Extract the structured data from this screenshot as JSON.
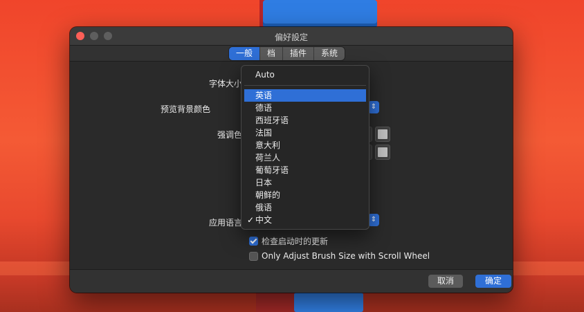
{
  "window": {
    "title": "偏好設定"
  },
  "tabs": [
    {
      "label": "一般",
      "active": true
    },
    {
      "label": "档",
      "active": false
    },
    {
      "label": "插件",
      "active": false
    },
    {
      "label": "系统",
      "active": false
    }
  ],
  "settings": {
    "font_size_label": "字体大小",
    "preview_bg_label": "预览背景颜色",
    "accent_label": "强调色",
    "app_language_label": "应用语言",
    "check_updates_label": "检查启动时的更新",
    "check_updates_checked": true,
    "brush_scroll_label": "Only Adjust Brush Size with Scroll Wheel",
    "brush_scroll_checked": false
  },
  "language_menu": {
    "auto_label": "Auto",
    "items": [
      "英语",
      "德语",
      "西班牙语",
      "法国",
      "意大利",
      "荷兰人",
      "葡萄牙语",
      "日本",
      "朝鲜的",
      "俄语",
      "中文"
    ],
    "highlighted": "英语",
    "selected": "中文",
    "check_glyph": "✓"
  },
  "footer": {
    "cancel_label": "取消",
    "ok_label": "确定"
  },
  "colors": {
    "accent": "#2f6fd6",
    "window_bg": "#2a2a2a",
    "close_light": "#fe5f57"
  },
  "icons": {
    "popup_arrow": "chevron-up-down-icon",
    "checkmark": "checkmark-icon"
  }
}
